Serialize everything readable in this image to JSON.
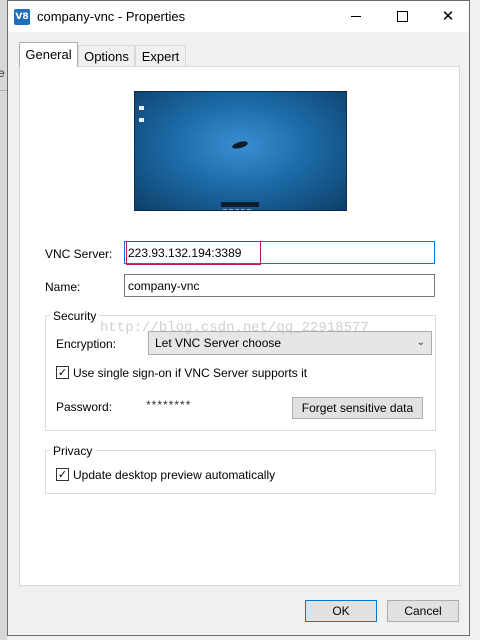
{
  "background": {
    "edge_text": "e"
  },
  "window": {
    "icon_text": "V8",
    "title": "company-vnc - Properties",
    "minimize_icon": "minimize-icon",
    "maximize_icon": "maximize-icon",
    "close_glyph": "✕"
  },
  "tabs": [
    {
      "label": "General",
      "active": true
    },
    {
      "label": "Options",
      "active": false
    },
    {
      "label": "Expert",
      "active": false
    }
  ],
  "general": {
    "vnc_server_label": "VNC Server:",
    "vnc_server_value": "223.93.132.194:3389",
    "name_label": "Name:",
    "name_value": "company-vnc"
  },
  "security": {
    "legend": "Security",
    "encryption_label": "Encryption:",
    "encryption_value": "Let VNC Server choose",
    "sso_label": "Use single sign-on if VNC Server supports it",
    "sso_checked": true,
    "check_glyph": "✓",
    "password_label": "Password:",
    "password_value": "********",
    "forget_button": "Forget sensitive data"
  },
  "privacy": {
    "legend": "Privacy",
    "update_preview_label": "Update desktop preview automatically",
    "update_preview_checked": true
  },
  "footer": {
    "ok_label": "OK",
    "cancel_label": "Cancel"
  },
  "watermark": "http://blog.csdn.net/qq_22918577",
  "colors": {
    "accent": "#0078d7",
    "highlight_box": "#c2185b"
  }
}
